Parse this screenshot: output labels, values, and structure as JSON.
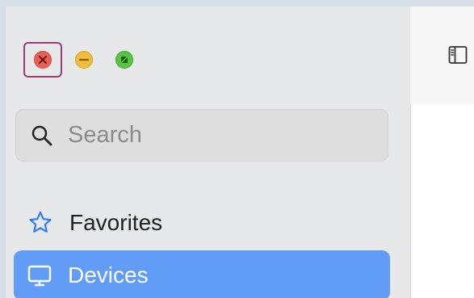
{
  "window": {
    "controls": {
      "close_icon": "close-icon",
      "minimize_icon": "minimize-icon",
      "zoom_icon": "zoom-icon"
    },
    "toolbar_icon": "sidebar-toggle-icon"
  },
  "sidebar": {
    "search": {
      "placeholder": "Search",
      "value": ""
    },
    "items": [
      {
        "label": "Favorites",
        "icon": "star-icon"
      },
      {
        "label": "Devices",
        "icon": "monitor-icon",
        "selected": true
      }
    ]
  },
  "colors": {
    "selection": "#619cf7",
    "sidebar_bg": "#e7e8e9",
    "close": "#ea5f57",
    "minimize": "#f2be3a",
    "zoom": "#59c443",
    "focus_ring": "#9d3b77",
    "accent_icon": "#2f7cf6"
  }
}
